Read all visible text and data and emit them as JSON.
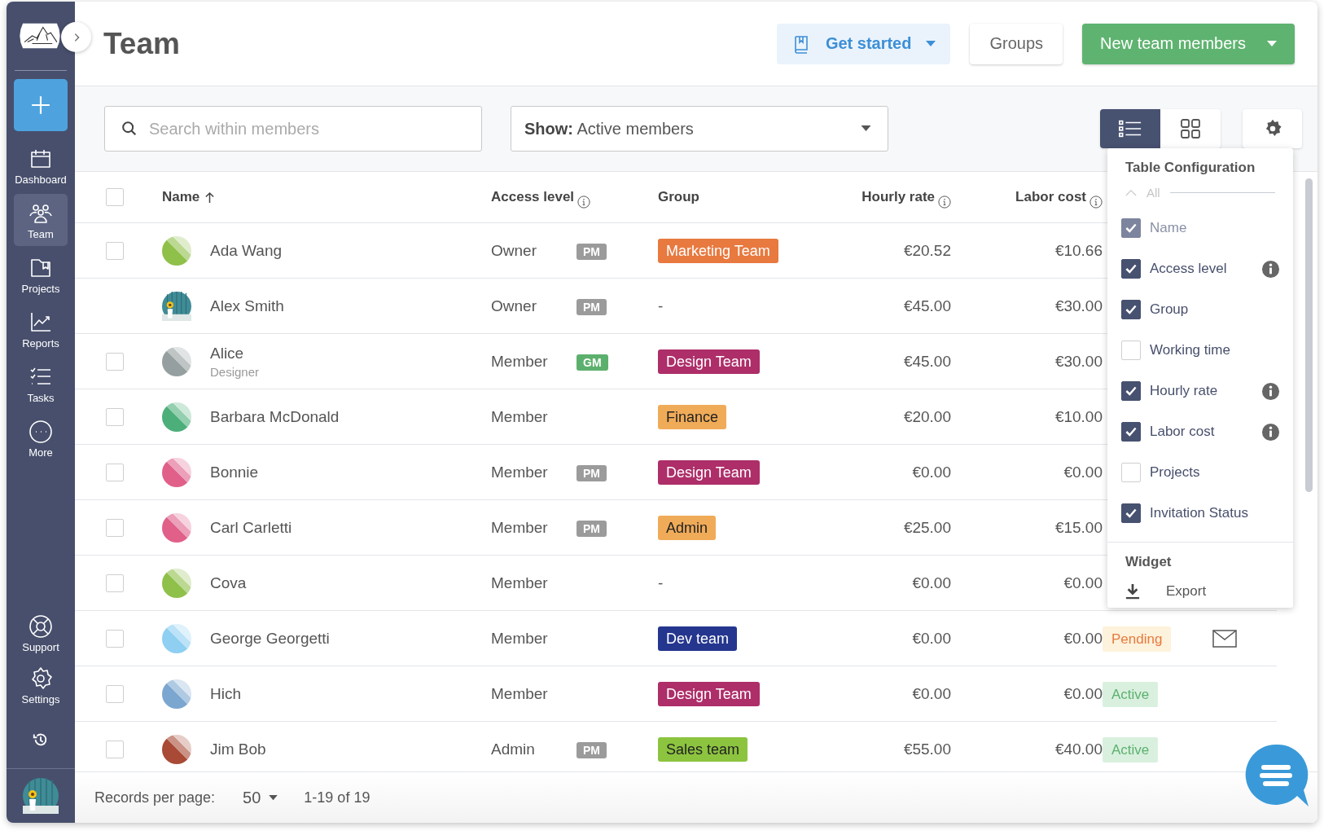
{
  "sidebar": {
    "items": [
      {
        "label": "Dashboard",
        "selected": false
      },
      {
        "label": "Team",
        "selected": true
      },
      {
        "label": "Projects",
        "selected": false
      },
      {
        "label": "Reports",
        "selected": false
      },
      {
        "label": "Tasks",
        "selected": false
      },
      {
        "label": "More",
        "selected": false
      }
    ],
    "bottom_items": [
      {
        "label": "Support"
      },
      {
        "label": "Settings"
      }
    ]
  },
  "header": {
    "title": "Team",
    "buttons": [
      {
        "label": "Get started",
        "kind": "guide"
      },
      {
        "label": "Groups",
        "kind": "plain"
      },
      {
        "label": "New team members",
        "kind": "primary"
      }
    ]
  },
  "toolbar": {
    "search": {
      "placeholder": "Search within members"
    },
    "filter": {
      "prefix": "Show:",
      "value": "Active members"
    },
    "views": [
      {
        "kind": "list",
        "selected": true
      },
      {
        "kind": "grid",
        "selected": false
      }
    ]
  },
  "table": {
    "all_selected": false,
    "columns": [
      {
        "label": "Name",
        "sorted": true,
        "info": false
      },
      {
        "label": "Access level",
        "sorted": false,
        "info": true
      },
      {
        "label": "Group",
        "sorted": false,
        "info": false
      },
      {
        "label": "Hourly rate",
        "sorted": false,
        "info": true
      },
      {
        "label": "Labor cost",
        "sorted": false,
        "info": true
      }
    ],
    "rows": [
      {
        "name": "Ada Wang",
        "selectable": true,
        "selected": false,
        "avatar": {
          "kind": "pattern",
          "color": "#8fc04a"
        },
        "access": "Owner",
        "badge": {
          "label": "PM",
          "color": "#9b9b9b"
        },
        "group": {
          "kind": "tag",
          "label": "Marketing Team",
          "color": "#e8793f",
          "dark_text": false
        },
        "hourly": "€20.52",
        "labor": "€10.66"
      },
      {
        "name": "Alex Smith",
        "selectable": false,
        "selected": false,
        "access": "Owner",
        "badge": {
          "label": "PM",
          "color": "#9b9b9b"
        },
        "group": {
          "kind": "none",
          "label": "-"
        },
        "hourly": "€45.00",
        "labor": "€30.00"
      },
      {
        "name": "Alice",
        "subtitle": "Designer",
        "selectable": true,
        "selected": false,
        "avatar": {
          "kind": "pattern",
          "color": "#959f9f"
        },
        "access": "Member",
        "badge": {
          "label": "GM",
          "color": "#5cb06d"
        },
        "group": {
          "kind": "tag",
          "label": "Design Team",
          "color": "#ad2e69",
          "dark_text": false
        },
        "hourly": "€45.00",
        "labor": "€30.00"
      },
      {
        "name": "Barbara McDonald",
        "selectable": true,
        "selected": false,
        "avatar": {
          "kind": "pattern",
          "color": "#4caf7a"
        },
        "access": "Member",
        "group": {
          "kind": "tag",
          "label": "Finance",
          "color": "#f0ab58",
          "dark_text": true
        },
        "hourly": "€20.00",
        "labor": "€10.00"
      },
      {
        "name": "Bonnie",
        "selectable": true,
        "selected": false,
        "avatar": {
          "kind": "pattern",
          "color": "#e0608a"
        },
        "access": "Member",
        "badge": {
          "label": "PM",
          "color": "#9b9b9b"
        },
        "group": {
          "kind": "tag",
          "label": "Design Team",
          "color": "#ad2e69",
          "dark_text": false
        },
        "hourly": "€0.00",
        "labor": "€0.00"
      },
      {
        "name": "Carl Carletti",
        "selectable": true,
        "selected": false,
        "avatar": {
          "kind": "pattern",
          "color": "#e0608a"
        },
        "access": "Member",
        "badge": {
          "label": "PM",
          "color": "#9b9b9b"
        },
        "group": {
          "kind": "tag",
          "label": "Admin",
          "color": "#f0ab58",
          "dark_text": true
        },
        "hourly": "€25.00",
        "labor": "€15.00"
      },
      {
        "name": "Cova",
        "selectable": true,
        "selected": false,
        "avatar": {
          "kind": "pattern",
          "color": "#8fc04a"
        },
        "access": "Member",
        "group": {
          "kind": "none",
          "label": "-"
        },
        "hourly": "€0.00",
        "labor": "€0.00"
      },
      {
        "name": "George Georgetti",
        "selectable": true,
        "selected": false,
        "avatar": {
          "kind": "pattern",
          "color": "#8ecff2"
        },
        "access": "Member",
        "group": {
          "kind": "tag",
          "label": "Dev team",
          "color": "#24368e",
          "dark_text": false
        },
        "hourly": "€0.00",
        "labor": "€0.00",
        "status": {
          "label": "Pending",
          "kind": "pending"
        },
        "resend": true
      },
      {
        "name": "Hich",
        "selectable": true,
        "selected": false,
        "avatar": {
          "kind": "pattern",
          "color": "#7ba6d0"
        },
        "access": "Member",
        "group": {
          "kind": "tag",
          "label": "Design Team",
          "color": "#ad2e69",
          "dark_text": false
        },
        "hourly": "€0.00",
        "labor": "€0.00",
        "status": {
          "label": "Active",
          "kind": "active"
        },
        "resend": false
      },
      {
        "name": "Jim Bob",
        "selectable": true,
        "selected": false,
        "avatar": {
          "kind": "pattern",
          "color": "#a84a35"
        },
        "access": "Admin",
        "badge": {
          "label": "PM",
          "color": "#9b9b9b"
        },
        "group": {
          "kind": "tag",
          "label": "Sales team",
          "color": "#8cc43f",
          "dark_text": true
        },
        "hourly": "€55.00",
        "labor": "€40.00",
        "status": {
          "label": "Active",
          "kind": "active"
        },
        "resend": false
      }
    ]
  },
  "config_menu": {
    "title": "Table Configuration",
    "all_label": "All",
    "items": [
      {
        "label": "Name",
        "checked": true,
        "disabled": true,
        "info": false
      },
      {
        "label": "Access level",
        "checked": true,
        "disabled": false,
        "info": true
      },
      {
        "label": "Group",
        "checked": true,
        "disabled": false,
        "info": false
      },
      {
        "label": "Working time",
        "checked": false,
        "disabled": false,
        "info": false
      },
      {
        "label": "Hourly rate",
        "checked": true,
        "disabled": false,
        "info": true
      },
      {
        "label": "Labor cost",
        "checked": true,
        "disabled": false,
        "info": true
      },
      {
        "label": "Projects",
        "checked": false,
        "disabled": false,
        "info": false
      },
      {
        "label": "Invitation Status",
        "checked": true,
        "disabled": false,
        "info": false
      }
    ],
    "widget_title": "Widget",
    "widget_items": [
      {
        "label": "Export"
      }
    ]
  },
  "footer": {
    "records_label": "Records per page:",
    "per_page": "50",
    "range": "1-19 of 19"
  }
}
